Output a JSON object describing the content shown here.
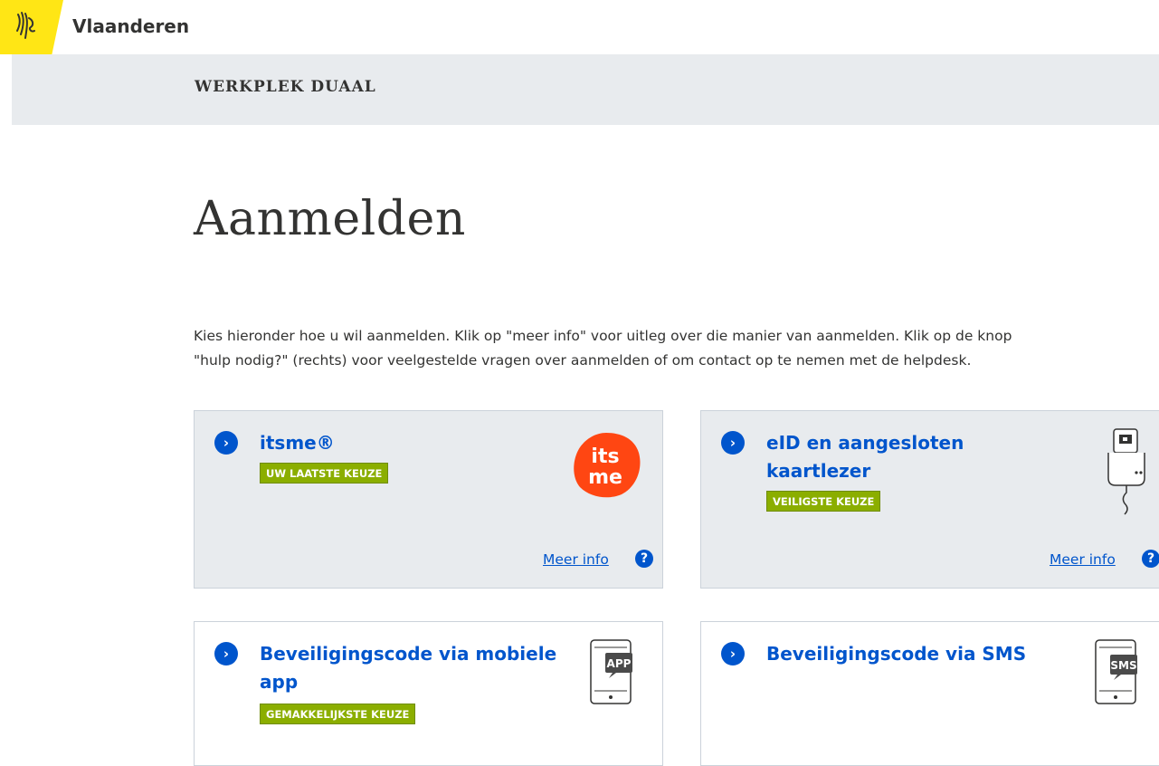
{
  "brand": {
    "name": "Vlaanderen"
  },
  "header": {
    "site_title": "WERKPLEK DUAAL"
  },
  "main": {
    "title": "Aanmelden",
    "intro_line1": "Kies hieronder hoe u wil aanmelden. Klik op \"meer info\" voor uitleg over die manier van aanmelden. Klik op de knop",
    "intro_line2": "\"hulp nodig?\" (rechts) voor veelgestelde vragen over aanmelden of om contact op te nemen met de helpdesk."
  },
  "options": [
    {
      "title": "itsme®",
      "badge": "UW LAATSTE KEUZE",
      "more": "Meer info",
      "icon": "itsme-logo"
    },
    {
      "title_line1": "eID en aangesloten",
      "title_line2": "kaartlezer",
      "badge": "VEILIGSTE KEUZE",
      "more": "Meer info",
      "icon": "card-reader-icon"
    },
    {
      "title_line1": "Beveiligingscode via mobiele",
      "title_line2": "app",
      "badge": "GEMAKKELIJKSTE KEUZE",
      "icon": "app-phone-icon",
      "icon_label": "APP"
    },
    {
      "title": "Beveiligingscode via SMS",
      "icon": "sms-phone-icon",
      "icon_label": "SMS"
    }
  ],
  "colors": {
    "accent": "#0055cc",
    "badge": "#8bae00",
    "brand_yellow": "#ffe615",
    "itsme": "#ff4612",
    "card_grey": "#e8ebee"
  }
}
